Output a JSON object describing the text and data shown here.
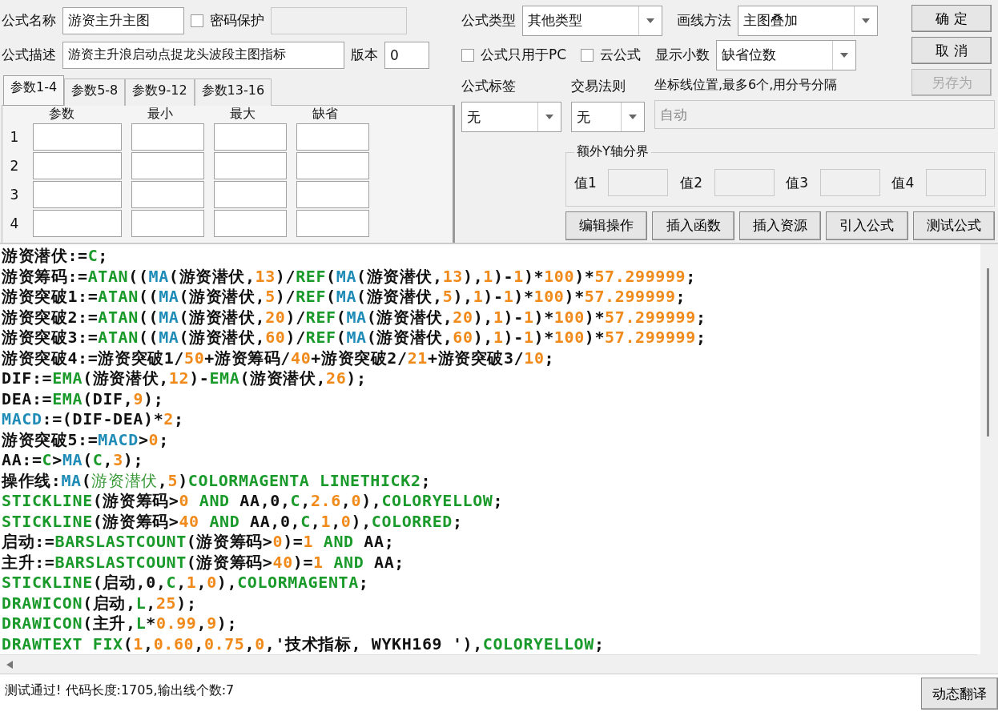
{
  "form": {
    "name_label": "公式名称",
    "name_value": "游资主升主图",
    "password": {
      "label": "密码保护",
      "checked": false
    },
    "desc_label": "公式描述",
    "desc_value": "游资主升浪启动点捉龙头波段主图指标",
    "version_label": "版本",
    "version_value": "0"
  },
  "param_tabs": [
    {
      "label": "参数1-4",
      "selected": true
    },
    {
      "label": "参数5-8",
      "selected": false
    },
    {
      "label": "参数9-12",
      "selected": false
    },
    {
      "label": "参数13-16",
      "selected": false
    }
  ],
  "param_table": {
    "columns": [
      "参数",
      "最小",
      "最大",
      "缺省"
    ],
    "rows": [
      "1",
      "2",
      "3",
      "4"
    ]
  },
  "formula_type": {
    "label": "公式类型",
    "value": "其他类型"
  },
  "draw_method": {
    "label": "画线方法",
    "value": "主图叠加"
  },
  "pc_only": {
    "label": "公式只用于PC",
    "checked": false
  },
  "cloud": {
    "label": "云公式",
    "checked": false
  },
  "decimals": {
    "label": "显示小数",
    "value": "缺省位数"
  },
  "tag": {
    "label": "公式标签",
    "value": "无"
  },
  "trade_rule": {
    "label": "交易法则",
    "value": "无"
  },
  "axis_lines": {
    "label": "坐标线位置,最多6个,用分号分隔",
    "placeholder": "自动",
    "disabled": true
  },
  "y_bounds": {
    "title": "额外Y轴分界",
    "labels": [
      "值1",
      "值2",
      "值3",
      "值4"
    ]
  },
  "side_buttons": [
    {
      "label": "确 定",
      "disabled": false
    },
    {
      "label": "取 消",
      "disabled": false
    },
    {
      "label": "另存为",
      "disabled": true
    }
  ],
  "tool_buttons": [
    "编辑操作",
    "插入函数",
    "插入资源",
    "引入公式",
    "测试公式"
  ],
  "code_lines": [
    [
      {
        "kind": "text",
        "text": "游资潜伏:="
      },
      {
        "kind": "func",
        "text": "C"
      },
      {
        "kind": "text",
        "text": ";"
      }
    ],
    [
      {
        "kind": "text",
        "text": "游资筹码:="
      },
      {
        "kind": "func",
        "text": "ATAN"
      },
      {
        "kind": "text",
        "text": "(("
      },
      {
        "kind": "ma",
        "text": "MA"
      },
      {
        "kind": "text",
        "text": "(游资潜伏,"
      },
      {
        "kind": "num",
        "text": "13"
      },
      {
        "kind": "text",
        "text": ")/"
      },
      {
        "kind": "func",
        "text": "REF"
      },
      {
        "kind": "text",
        "text": "("
      },
      {
        "kind": "ma",
        "text": "MA"
      },
      {
        "kind": "text",
        "text": "(游资潜伏,"
      },
      {
        "kind": "num",
        "text": "13"
      },
      {
        "kind": "text",
        "text": "),"
      },
      {
        "kind": "num",
        "text": "1"
      },
      {
        "kind": "text",
        "text": ")-"
      },
      {
        "kind": "num",
        "text": "1"
      },
      {
        "kind": "text",
        "text": ")*"
      },
      {
        "kind": "num",
        "text": "100"
      },
      {
        "kind": "text",
        "text": ")*"
      },
      {
        "kind": "num",
        "text": "57.299999"
      },
      {
        "kind": "text",
        "text": ";"
      }
    ],
    [
      {
        "kind": "text",
        "text": "游资突破1:="
      },
      {
        "kind": "func",
        "text": "ATAN"
      },
      {
        "kind": "text",
        "text": "(("
      },
      {
        "kind": "ma",
        "text": "MA"
      },
      {
        "kind": "text",
        "text": "(游资潜伏,"
      },
      {
        "kind": "num",
        "text": "5"
      },
      {
        "kind": "text",
        "text": ")/"
      },
      {
        "kind": "func",
        "text": "REF"
      },
      {
        "kind": "text",
        "text": "("
      },
      {
        "kind": "ma",
        "text": "MA"
      },
      {
        "kind": "text",
        "text": "(游资潜伏,"
      },
      {
        "kind": "num",
        "text": "5"
      },
      {
        "kind": "text",
        "text": "),"
      },
      {
        "kind": "num",
        "text": "1"
      },
      {
        "kind": "text",
        "text": ")-"
      },
      {
        "kind": "num",
        "text": "1"
      },
      {
        "kind": "text",
        "text": ")*"
      },
      {
        "kind": "num",
        "text": "100"
      },
      {
        "kind": "text",
        "text": ")*"
      },
      {
        "kind": "num",
        "text": "57.299999"
      },
      {
        "kind": "text",
        "text": ";"
      }
    ],
    [
      {
        "kind": "text",
        "text": "游资突破2:="
      },
      {
        "kind": "func",
        "text": "ATAN"
      },
      {
        "kind": "text",
        "text": "(("
      },
      {
        "kind": "ma",
        "text": "MA"
      },
      {
        "kind": "text",
        "text": "(游资潜伏,"
      },
      {
        "kind": "num",
        "text": "20"
      },
      {
        "kind": "text",
        "text": ")/"
      },
      {
        "kind": "func",
        "text": "REF"
      },
      {
        "kind": "text",
        "text": "("
      },
      {
        "kind": "ma",
        "text": "MA"
      },
      {
        "kind": "text",
        "text": "(游资潜伏,"
      },
      {
        "kind": "num",
        "text": "20"
      },
      {
        "kind": "text",
        "text": "),"
      },
      {
        "kind": "num",
        "text": "1"
      },
      {
        "kind": "text",
        "text": ")-"
      },
      {
        "kind": "num",
        "text": "1"
      },
      {
        "kind": "text",
        "text": ")*"
      },
      {
        "kind": "num",
        "text": "100"
      },
      {
        "kind": "text",
        "text": ")*"
      },
      {
        "kind": "num",
        "text": "57.299999"
      },
      {
        "kind": "text",
        "text": ";"
      }
    ],
    [
      {
        "kind": "text",
        "text": "游资突破3:="
      },
      {
        "kind": "func",
        "text": "ATAN"
      },
      {
        "kind": "text",
        "text": "(("
      },
      {
        "kind": "ma",
        "text": "MA"
      },
      {
        "kind": "text",
        "text": "(游资潜伏,"
      },
      {
        "kind": "num",
        "text": "60"
      },
      {
        "kind": "text",
        "text": ")/"
      },
      {
        "kind": "func",
        "text": "REF"
      },
      {
        "kind": "text",
        "text": "("
      },
      {
        "kind": "ma",
        "text": "MA"
      },
      {
        "kind": "text",
        "text": "(游资潜伏,"
      },
      {
        "kind": "num",
        "text": "60"
      },
      {
        "kind": "text",
        "text": "),"
      },
      {
        "kind": "num",
        "text": "1"
      },
      {
        "kind": "text",
        "text": ")-"
      },
      {
        "kind": "num",
        "text": "1"
      },
      {
        "kind": "text",
        "text": ")*"
      },
      {
        "kind": "num",
        "text": "100"
      },
      {
        "kind": "text",
        "text": ")*"
      },
      {
        "kind": "num",
        "text": "57.299999"
      },
      {
        "kind": "text",
        "text": ";"
      }
    ],
    [
      {
        "kind": "text",
        "text": "游资突破4:=游资突破1/"
      },
      {
        "kind": "num",
        "text": "50"
      },
      {
        "kind": "text",
        "text": "+游资筹码/"
      },
      {
        "kind": "num",
        "text": "40"
      },
      {
        "kind": "text",
        "text": "+游资突破2/"
      },
      {
        "kind": "num",
        "text": "21"
      },
      {
        "kind": "text",
        "text": "+游资突破3/"
      },
      {
        "kind": "num",
        "text": "10"
      },
      {
        "kind": "text",
        "text": ";"
      }
    ],
    [
      {
        "kind": "text",
        "text": "DIF:="
      },
      {
        "kind": "func",
        "text": "EMA"
      },
      {
        "kind": "text",
        "text": "(游资潜伏,"
      },
      {
        "kind": "num",
        "text": "12"
      },
      {
        "kind": "text",
        "text": ")-"
      },
      {
        "kind": "func",
        "text": "EMA"
      },
      {
        "kind": "text",
        "text": "(游资潜伏,"
      },
      {
        "kind": "num",
        "text": "26"
      },
      {
        "kind": "text",
        "text": ");"
      }
    ],
    [
      {
        "kind": "text",
        "text": "DEA:="
      },
      {
        "kind": "func",
        "text": "EMA"
      },
      {
        "kind": "text",
        "text": "(DIF,"
      },
      {
        "kind": "num",
        "text": "9"
      },
      {
        "kind": "text",
        "text": ");"
      }
    ],
    [
      {
        "kind": "ma",
        "text": "MACD"
      },
      {
        "kind": "text",
        "text": ":=(DIF-DEA)*"
      },
      {
        "kind": "num",
        "text": "2"
      },
      {
        "kind": "text",
        "text": ";"
      }
    ],
    [
      {
        "kind": "text",
        "text": "游资突破5:="
      },
      {
        "kind": "ma",
        "text": "MACD"
      },
      {
        "kind": "text",
        "text": ">"
      },
      {
        "kind": "num",
        "text": "0"
      },
      {
        "kind": "text",
        "text": ";"
      }
    ],
    [
      {
        "kind": "text",
        "text": "AA:="
      },
      {
        "kind": "func",
        "text": "C"
      },
      {
        "kind": "text",
        "text": ">"
      },
      {
        "kind": "ma",
        "text": "MA"
      },
      {
        "kind": "text",
        "text": "("
      },
      {
        "kind": "func",
        "text": "C"
      },
      {
        "kind": "text",
        "text": ","
      },
      {
        "kind": "num",
        "text": "3"
      },
      {
        "kind": "text",
        "text": ");"
      }
    ],
    [
      {
        "kind": "text",
        "text": "操作线:"
      },
      {
        "kind": "ma",
        "text": "MA"
      },
      {
        "kind": "text",
        "text": "("
      },
      {
        "kind": "name",
        "text": "游资潜伏"
      },
      {
        "kind": "text",
        "text": ","
      },
      {
        "kind": "num",
        "text": "5"
      },
      {
        "kind": "text",
        "text": ")"
      },
      {
        "kind": "func",
        "text": "COLORMAGENTA LINETHICK2"
      },
      {
        "kind": "text",
        "text": ";"
      }
    ],
    [
      {
        "kind": "func",
        "text": "STICKLINE"
      },
      {
        "kind": "text",
        "text": "(游资筹码>"
      },
      {
        "kind": "num",
        "text": "0"
      },
      {
        "kind": "func",
        "text": " AND "
      },
      {
        "kind": "text",
        "text": "AA,0,"
      },
      {
        "kind": "func",
        "text": "C"
      },
      {
        "kind": "text",
        "text": ","
      },
      {
        "kind": "num",
        "text": "2.6"
      },
      {
        "kind": "text",
        "text": ","
      },
      {
        "kind": "num",
        "text": "0"
      },
      {
        "kind": "text",
        "text": "),"
      },
      {
        "kind": "func",
        "text": "COLORYELLOW"
      },
      {
        "kind": "text",
        "text": ";"
      }
    ],
    [
      {
        "kind": "func",
        "text": "STICKLINE"
      },
      {
        "kind": "text",
        "text": "(游资筹码>"
      },
      {
        "kind": "num",
        "text": "40"
      },
      {
        "kind": "func",
        "text": " AND "
      },
      {
        "kind": "text",
        "text": "AA,0,"
      },
      {
        "kind": "func",
        "text": "C"
      },
      {
        "kind": "text",
        "text": ","
      },
      {
        "kind": "num",
        "text": "1"
      },
      {
        "kind": "text",
        "text": ","
      },
      {
        "kind": "num",
        "text": "0"
      },
      {
        "kind": "text",
        "text": "),"
      },
      {
        "kind": "func",
        "text": "COLORRED"
      },
      {
        "kind": "text",
        "text": ";"
      }
    ],
    [
      {
        "kind": "text",
        "text": "启动:="
      },
      {
        "kind": "func",
        "text": "BARSLASTCOUNT"
      },
      {
        "kind": "text",
        "text": "(游资筹码>"
      },
      {
        "kind": "num",
        "text": "0"
      },
      {
        "kind": "text",
        "text": ")="
      },
      {
        "kind": "num",
        "text": "1"
      },
      {
        "kind": "func",
        "text": " AND "
      },
      {
        "kind": "text",
        "text": "AA;"
      }
    ],
    [
      {
        "kind": "text",
        "text": "主升:="
      },
      {
        "kind": "func",
        "text": "BARSLASTCOUNT"
      },
      {
        "kind": "text",
        "text": "(游资筹码>"
      },
      {
        "kind": "num",
        "text": "40"
      },
      {
        "kind": "text",
        "text": ")="
      },
      {
        "kind": "num",
        "text": "1"
      },
      {
        "kind": "func",
        "text": " AND "
      },
      {
        "kind": "text",
        "text": "AA;"
      }
    ],
    [
      {
        "kind": "func",
        "text": "STICKLINE"
      },
      {
        "kind": "text",
        "text": "(启动,0,"
      },
      {
        "kind": "func",
        "text": "C"
      },
      {
        "kind": "text",
        "text": ","
      },
      {
        "kind": "num",
        "text": "1"
      },
      {
        "kind": "text",
        "text": ","
      },
      {
        "kind": "num",
        "text": "0"
      },
      {
        "kind": "text",
        "text": "),"
      },
      {
        "kind": "func",
        "text": "COLORMAGENTA"
      },
      {
        "kind": "text",
        "text": ";"
      }
    ],
    [
      {
        "kind": "func",
        "text": "DRAWICON"
      },
      {
        "kind": "text",
        "text": "(启动,"
      },
      {
        "kind": "func",
        "text": "L"
      },
      {
        "kind": "text",
        "text": ","
      },
      {
        "kind": "num",
        "text": "25"
      },
      {
        "kind": "text",
        "text": ");"
      }
    ],
    [
      {
        "kind": "func",
        "text": "DRAWICON"
      },
      {
        "kind": "text",
        "text": "(主升,"
      },
      {
        "kind": "func",
        "text": "L"
      },
      {
        "kind": "text",
        "text": "*"
      },
      {
        "kind": "num",
        "text": "0.99"
      },
      {
        "kind": "text",
        "text": ","
      },
      {
        "kind": "num",
        "text": "9"
      },
      {
        "kind": "text",
        "text": ");"
      }
    ],
    [
      {
        "kind": "func",
        "text": "DRAWTEXT FIX"
      },
      {
        "kind": "text",
        "text": "("
      },
      {
        "kind": "num",
        "text": "1"
      },
      {
        "kind": "text",
        "text": ","
      },
      {
        "kind": "num",
        "text": "0.60"
      },
      {
        "kind": "text",
        "text": ","
      },
      {
        "kind": "num",
        "text": "0.75"
      },
      {
        "kind": "text",
        "text": ","
      },
      {
        "kind": "num",
        "text": "0"
      },
      {
        "kind": "text",
        "text": ",'技术指标, WYKH169 '),"
      },
      {
        "kind": "func",
        "text": "COLORYELLOW"
      },
      {
        "kind": "text",
        "text": ";"
      }
    ]
  ],
  "status": "测试通过! 代码长度:1705,输出线个数:7",
  "translate_button": "动态翻译"
}
